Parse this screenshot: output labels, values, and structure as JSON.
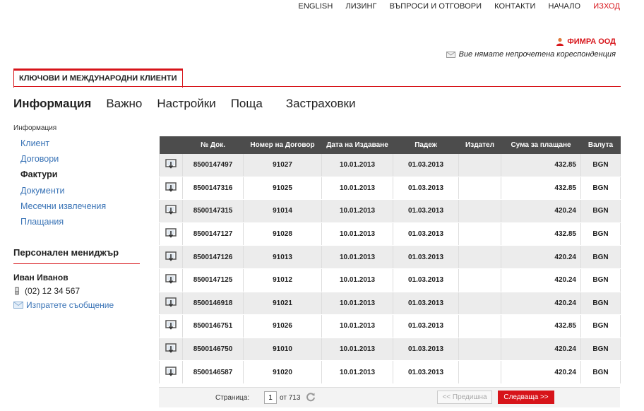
{
  "top_nav": {
    "english": "ENGLISH",
    "leasing": "ЛИЗИНГ",
    "faq": "ВЪПРОСИ И ОТГОВОРИ",
    "contacts": "КОНТАКТИ",
    "home": "НАЧАЛО",
    "logout": "ИЗХОД"
  },
  "account": {
    "company": "ФИМРА ООД",
    "mail_note": "Вие нямате непрочетена кореспонденция"
  },
  "client_tab": "КЛЮЧОВИ И МЕЖДУНАРОДНИ КЛИЕНТИ",
  "main_nav": {
    "info": "Информация",
    "important": "Важно",
    "settings": "Настройки",
    "mail": "Поща",
    "insurance": "Застраховки"
  },
  "sidebar": {
    "heading": "Информация",
    "items": [
      "Клиент",
      "Договори",
      "Фактури",
      "Документи",
      "Месечни извлечения",
      "Плащания"
    ],
    "active_index": 2,
    "manager_title": "Персонален мениджър",
    "manager_name": "Иван Иванов",
    "manager_phone": "(02) 12 34 567",
    "manager_message": "Изпратете съобщение"
  },
  "table": {
    "headers": [
      "",
      "№ Док.",
      "Номер на Договор",
      "Дата на Издаване",
      "Падеж",
      "Издател",
      "Сума за плащане",
      "Валута"
    ],
    "rows": [
      {
        "doc": "8500147497",
        "contract": "91027",
        "issued": "10.01.2013",
        "due": "01.03.2013",
        "issuer": "",
        "amount": "432.85",
        "currency": "BGN"
      },
      {
        "doc": "8500147316",
        "contract": "91025",
        "issued": "10.01.2013",
        "due": "01.03.2013",
        "issuer": "",
        "amount": "432.85",
        "currency": "BGN"
      },
      {
        "doc": "8500147315",
        "contract": "91014",
        "issued": "10.01.2013",
        "due": "01.03.2013",
        "issuer": "",
        "amount": "420.24",
        "currency": "BGN"
      },
      {
        "doc": "8500147127",
        "contract": "91028",
        "issued": "10.01.2013",
        "due": "01.03.2013",
        "issuer": "",
        "amount": "432.85",
        "currency": "BGN"
      },
      {
        "doc": "8500147126",
        "contract": "91013",
        "issued": "10.01.2013",
        "due": "01.03.2013",
        "issuer": "",
        "amount": "420.24",
        "currency": "BGN"
      },
      {
        "doc": "8500147125",
        "contract": "91012",
        "issued": "10.01.2013",
        "due": "01.03.2013",
        "issuer": "",
        "amount": "420.24",
        "currency": "BGN"
      },
      {
        "doc": "8500146918",
        "contract": "91021",
        "issued": "10.01.2013",
        "due": "01.03.2013",
        "issuer": "",
        "amount": "420.24",
        "currency": "BGN"
      },
      {
        "doc": "8500146751",
        "contract": "91026",
        "issued": "10.01.2013",
        "due": "01.03.2013",
        "issuer": "",
        "amount": "432.85",
        "currency": "BGN"
      },
      {
        "doc": "8500146750",
        "contract": "91010",
        "issued": "10.01.2013",
        "due": "01.03.2013",
        "issuer": "",
        "amount": "420.24",
        "currency": "BGN"
      },
      {
        "doc": "8500146587",
        "contract": "91020",
        "issued": "10.01.2013",
        "due": "01.03.2013",
        "issuer": "",
        "amount": "420.24",
        "currency": "BGN"
      }
    ]
  },
  "pager": {
    "label": "Страница:",
    "current_page": "1",
    "total_text": "от 713",
    "prev": "<< Предишна",
    "next": "Следваща >>"
  },
  "colors": {
    "accent": "#d7141a",
    "link": "#3973b6",
    "header_bg": "#4c4c4c"
  },
  "icons": {
    "row_action": "download-document-icon",
    "company": "user-icon",
    "mail": "envelope-icon",
    "phone": "phone-icon",
    "refresh": "refresh-icon"
  }
}
